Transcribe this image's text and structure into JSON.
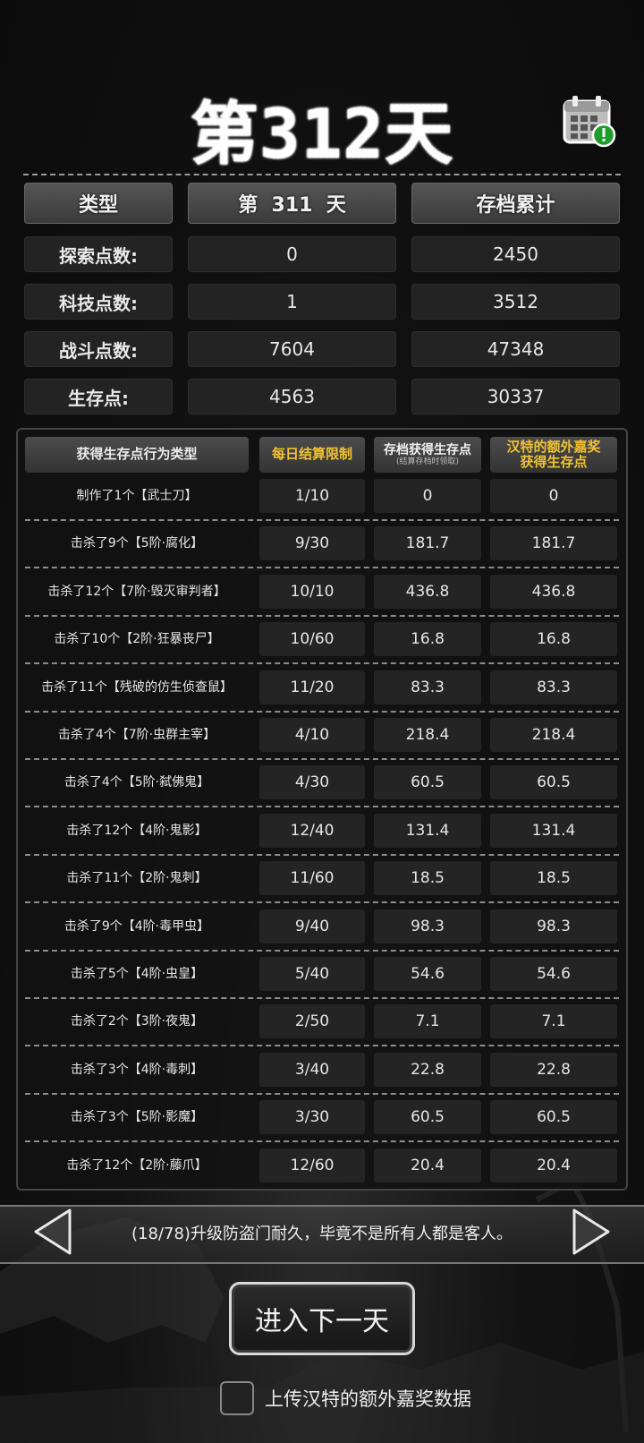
{
  "header": {
    "title": "第312天",
    "calendar_icon": "calendar-alert-icon"
  },
  "summary": {
    "headers": [
      "类型",
      "第  311  天",
      "存档累计"
    ],
    "rows": [
      {
        "label": "探索点数:",
        "day": "0",
        "total": "2450"
      },
      {
        "label": "科技点数:",
        "day": "1",
        "total": "3512"
      },
      {
        "label": "战斗点数:",
        "day": "7604",
        "total": "47348"
      },
      {
        "label": "生存点:",
        "day": "4563",
        "total": "30337"
      }
    ]
  },
  "table": {
    "col_type": "获得生存点行为类型",
    "col_limit": "每日结算限制",
    "col_archive": "存档获得生存点",
    "col_archive_note": "(结算存档时领取)",
    "col_bonus_line1": "汉特的额外嘉奖",
    "col_bonus_line2": "获得生存点",
    "rows": [
      {
        "name": "制作了1个【武士刀】",
        "limit": "1/10",
        "archive": "0",
        "bonus": "0"
      },
      {
        "name": "击杀了9个【5阶·腐化】",
        "limit": "9/30",
        "archive": "181.7",
        "bonus": "181.7"
      },
      {
        "name": "击杀了12个【7阶·毁灭审判者】",
        "limit": "10/10",
        "archive": "436.8",
        "bonus": "436.8"
      },
      {
        "name": "击杀了10个【2阶·狂暴丧尸】",
        "limit": "10/60",
        "archive": "16.8",
        "bonus": "16.8"
      },
      {
        "name": "击杀了11个【残破的仿生侦查鼠】",
        "limit": "11/20",
        "archive": "83.3",
        "bonus": "83.3"
      },
      {
        "name": "击杀了4个【7阶·虫群主宰】",
        "limit": "4/10",
        "archive": "218.4",
        "bonus": "218.4"
      },
      {
        "name": "击杀了4个【5阶·弑佛鬼】",
        "limit": "4/30",
        "archive": "60.5",
        "bonus": "60.5"
      },
      {
        "name": "击杀了12个【4阶·鬼影】",
        "limit": "12/40",
        "archive": "131.4",
        "bonus": "131.4"
      },
      {
        "name": "击杀了11个【2阶·鬼刺】",
        "limit": "11/60",
        "archive": "18.5",
        "bonus": "18.5"
      },
      {
        "name": "击杀了9个【4阶·毒甲虫】",
        "limit": "9/40",
        "archive": "98.3",
        "bonus": "98.3"
      },
      {
        "name": "击杀了5个【4阶·虫皇】",
        "limit": "5/40",
        "archive": "54.6",
        "bonus": "54.6"
      },
      {
        "name": "击杀了2个【3阶·夜鬼】",
        "limit": "2/50",
        "archive": "7.1",
        "bonus": "7.1"
      },
      {
        "name": "击杀了3个【4阶·毒刺】",
        "limit": "3/40",
        "archive": "22.8",
        "bonus": "22.8"
      },
      {
        "name": "击杀了3个【5阶·影魔】",
        "limit": "3/30",
        "archive": "60.5",
        "bonus": "60.5"
      },
      {
        "name": "击杀了12个【2阶·藤爪】",
        "limit": "12/60",
        "archive": "20.4",
        "bonus": "20.4"
      }
    ]
  },
  "tip": {
    "text": "(18/78)升级防盗门耐久，毕竟不是所有人都是客人。"
  },
  "actions": {
    "next_day": "进入下一天",
    "upload_label": "上传汉特的额外嘉奖数据"
  },
  "colors": {
    "gold": "#f1c232",
    "panel": "#242424"
  }
}
